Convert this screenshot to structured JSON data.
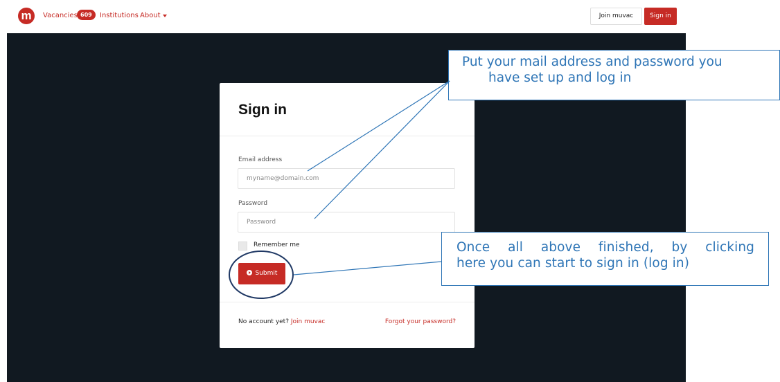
{
  "nav": {
    "logo_letter": "m",
    "vacancies_label": "Vacancies",
    "vacancies_count": "609",
    "institutions_label": "Institutions",
    "about_label": "About",
    "join_label": "Join muvac",
    "signin_label": "Sign in"
  },
  "form": {
    "title": "Sign in",
    "email_label": "Email address",
    "email_placeholder": "myname@domain.com",
    "password_label": "Password",
    "password_placeholder": "Password",
    "remember_label": "Remember me",
    "submit_label": "Submit",
    "no_account_text": "No account yet?",
    "join_link": "Join muvac",
    "forgot_link": "Forgot your password?"
  },
  "annotations": {
    "callout_top_line1": "Put your mail address and password you",
    "callout_top_line2": "have set up and log in",
    "callout_bottom_line1": "Once all above finished, by clicking",
    "callout_bottom_line2": "here you can start to sign in (log in)",
    "annotation_color": "#2e75b6"
  },
  "colors": {
    "brand": "#c62b25",
    "backdrop": "#111921"
  }
}
